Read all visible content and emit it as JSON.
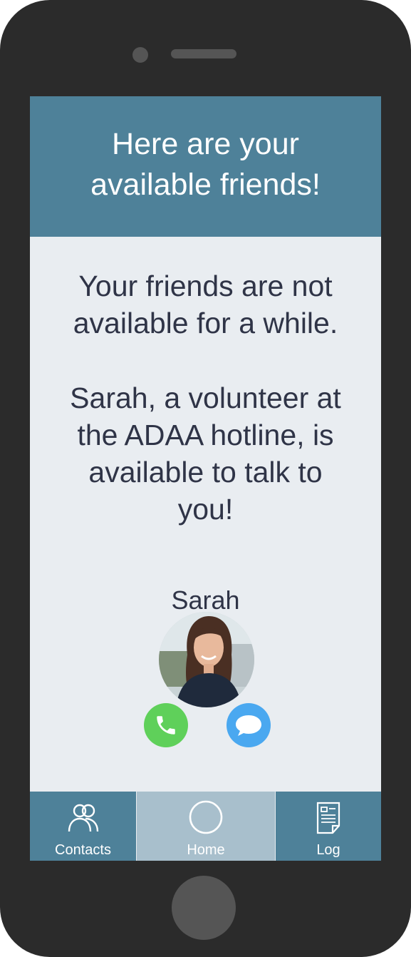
{
  "header": {
    "title": "Here are your\navailable friends!"
  },
  "message": {
    "line1": "Your friends are not\navailable for a while.",
    "line2": "Sarah, a volunteer at\nthe ADAA hotline, is\navailable to talk to\nyou!"
  },
  "contact": {
    "name": "Sarah",
    "actions": {
      "call_icon": "phone-icon",
      "message_icon": "chat-bubble-icon"
    }
  },
  "tabs": [
    {
      "label": "Contacts",
      "icon": "contacts-icon"
    },
    {
      "label": "Home",
      "icon": "circle-home-icon"
    },
    {
      "label": "Log",
      "icon": "document-icon"
    }
  ],
  "colors": {
    "header_bg": "#4e8199",
    "screen_bg": "#e9edf1",
    "text": "#2f3447",
    "call_green": "#5fd05a",
    "message_blue": "#4aa8f0",
    "tab_active_bg": "#a8bfcc",
    "tab_bg": "#4e8199"
  }
}
